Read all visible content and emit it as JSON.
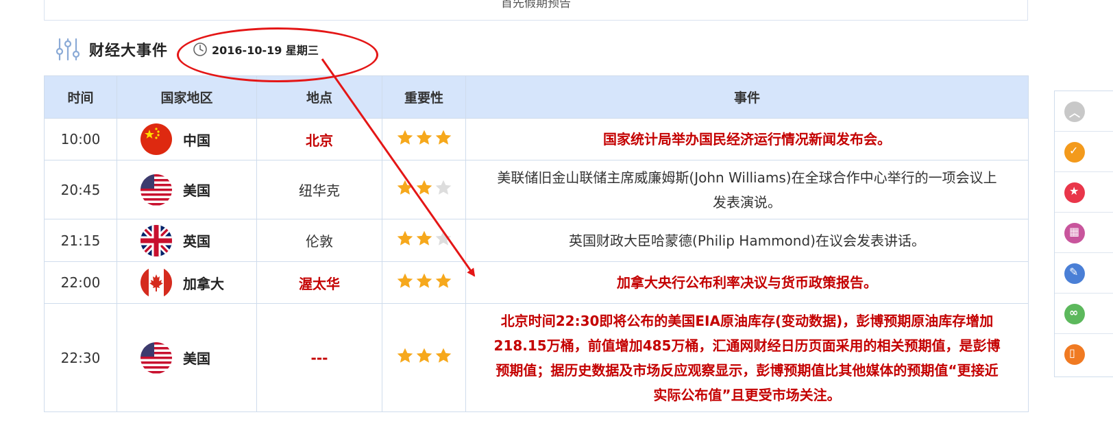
{
  "top_notice": "首先假期预告",
  "section": {
    "title": "财经大事件",
    "date": "2016-10-19 星期三"
  },
  "table": {
    "headers": [
      "时间",
      "国家地区",
      "地点",
      "重要性",
      "事件"
    ],
    "rows": [
      {
        "time": "10:00",
        "country": "中国",
        "flag": "china-flag",
        "location": "北京",
        "importance": 3,
        "event": "国家统计局举办国民经济运行情况新闻发布会。",
        "highlight": true
      },
      {
        "time": "20:45",
        "country": "美国",
        "flag": "usa-flag",
        "location": "纽华克",
        "importance": 2,
        "event": "美联储旧金山联储主席威廉姆斯(John Williams)在全球合作中心举行的一项会议上发表演说。",
        "highlight": false
      },
      {
        "time": "21:15",
        "country": "英国",
        "flag": "uk-flag",
        "location": "伦敦",
        "importance": 2,
        "event": "英国财政大臣哈蒙德(Philip Hammond)在议会发表讲话。",
        "highlight": false
      },
      {
        "time": "22:00",
        "country": "加拿大",
        "flag": "canada-flag",
        "location": "渥太华",
        "importance": 3,
        "event": "加拿大央行公布利率决议与货币政策报告。",
        "highlight": true
      },
      {
        "time": "22:30",
        "country": "美国",
        "flag": "usa-flag",
        "location": "---",
        "importance": 3,
        "event": "北京时间22:30即将公布的美国EIA原油库存(变动数据)，彭博预期原油库存增加218.15万桶，前值增加485万桶，汇通网财经日历页面采用的相关预期值，是彭博预期值；据历史数据及市场反应观察显示，彭博预期值比其他媒体的预期值“更接近实际公布值”且更受市场关注。",
        "highlight": true
      }
    ]
  },
  "right_bar": {
    "items": [
      {
        "icon": "chevron-up-icon",
        "color": "#c8c8c8"
      },
      {
        "icon": "check-badge-icon",
        "color": "#f39a1c"
      },
      {
        "icon": "star-badge-icon",
        "color": "#e9364a"
      },
      {
        "icon": "calendar-icon",
        "color": "#c8559c"
      },
      {
        "icon": "edit-icon",
        "color": "#4a7fd6"
      },
      {
        "icon": "link-icon",
        "color": "#5cb85c"
      },
      {
        "icon": "phone-icon",
        "color": "#f07a22"
      }
    ]
  },
  "colors": {
    "header_bg": "#d6e5fb",
    "highlight_text": "#c40000",
    "star_on": "#f6a81c",
    "star_off": "#dddddd",
    "annotation": "#e41616"
  }
}
